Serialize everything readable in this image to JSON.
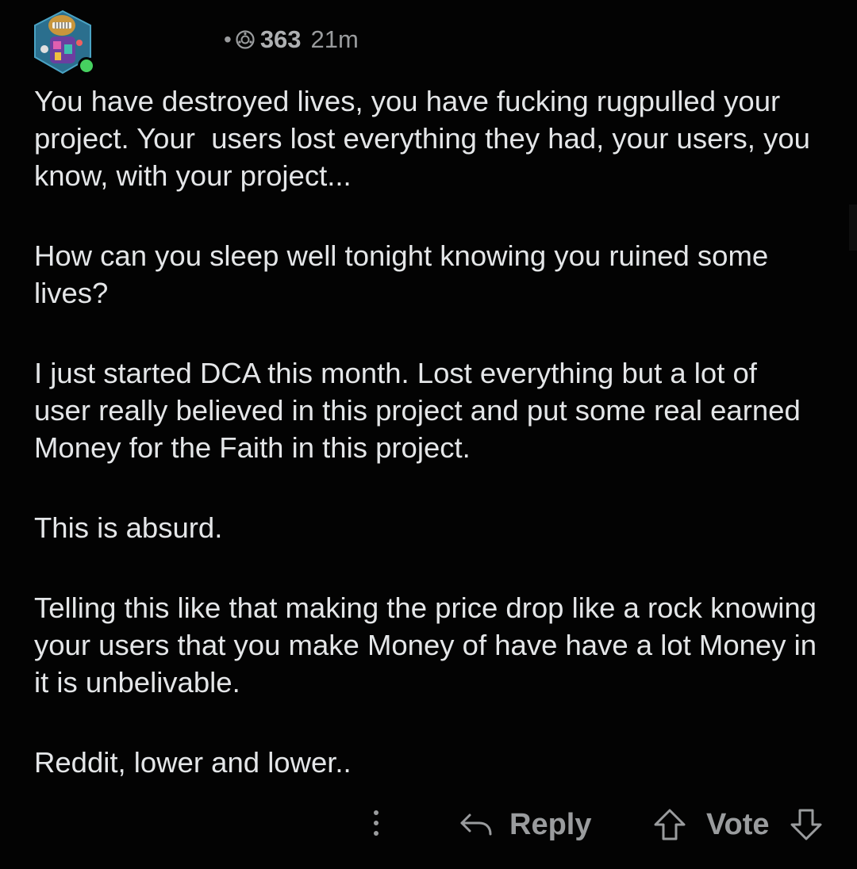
{
  "header": {
    "username": "",
    "karma": "363",
    "time_ago": "21m",
    "separator": "•",
    "karma_icon": "karma-icon",
    "online_status_color": "#46d160"
  },
  "comment": {
    "paragraphs": [
      "You have destroyed lives, you have fucking rugpulled your project. Your  users lost everything they had, your users, you know, with your project...",
      "How can you sleep well tonight knowing you ruined some lives?",
      "I just started DCA this month. Lost everything but a lot of user really believed in this project and put some real earned Money for the Faith in this project.",
      "This is absurd.",
      "Telling this like that making the price drop like a rock knowing your users that you make Money of have have a lot Money in it is unbelivable.",
      "Reddit, lower and lower.."
    ]
  },
  "actions": {
    "reply_label": "Reply",
    "vote_label": "Vote",
    "more_icon": "more-options-icon",
    "reply_icon": "reply-arrow-icon",
    "upvote_icon": "upvote-arrow-icon",
    "downvote_icon": "downvote-arrow-icon"
  },
  "colors": {
    "background": "#030303",
    "text": "#e4e6e8",
    "muted": "#9a9c9e"
  }
}
